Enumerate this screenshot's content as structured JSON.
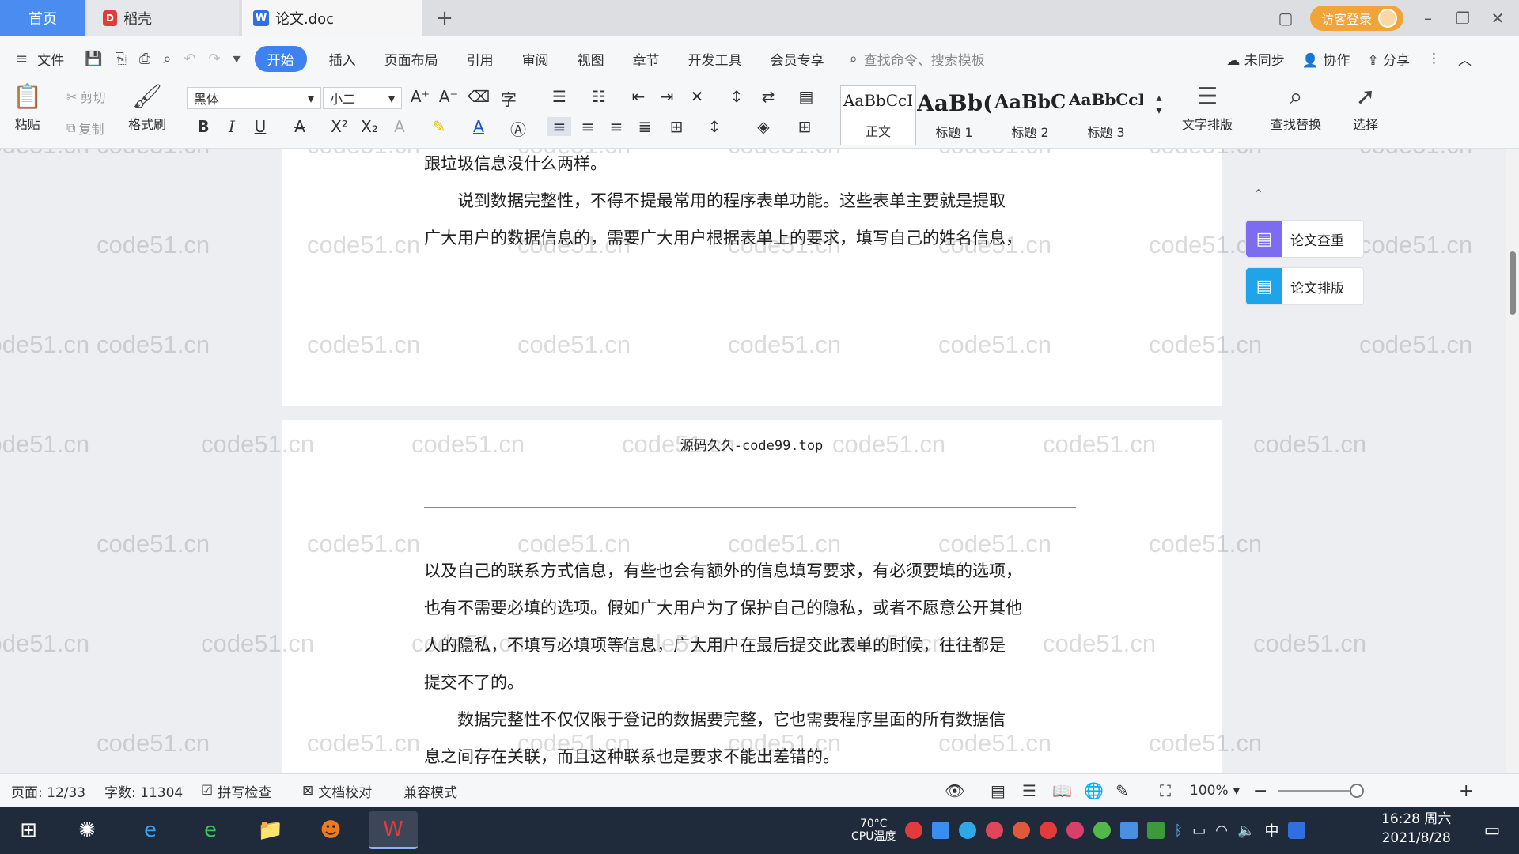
{
  "tabs": {
    "home": "首页",
    "docer": "稻壳",
    "doc": "论文.doc",
    "add": "+"
  },
  "titlebar": {
    "visitor_login": "访客登录"
  },
  "menu": {
    "file": "文件",
    "items": [
      "开始",
      "插入",
      "页面布局",
      "引用",
      "审阅",
      "视图",
      "章节",
      "开发工具",
      "会员专享"
    ],
    "search_command": "查找命令、搜索模板",
    "sync": "未同步",
    "collab": "协作",
    "share": "分享"
  },
  "ribbon": {
    "paste": "粘贴",
    "cut": "剪切",
    "copy": "复制",
    "format_painter": "格式刷",
    "font_name": "黑体",
    "font_size": "小二",
    "styles": [
      {
        "sample": "AaBbCcI",
        "name": "正文"
      },
      {
        "sample": "AaBb(",
        "name": "标题 1"
      },
      {
        "sample": "AaBbC",
        "name": "标题 2"
      },
      {
        "sample": "AaBbCcI",
        "name": "标题 3"
      }
    ],
    "text_layout": "文字排版",
    "find_replace": "查找替换",
    "select": "选择"
  },
  "document": {
    "page1_lines": [
      "跟垃圾信息没什么两样。",
      "　　说到数据完整性，不得不提最常用的程序表单功能。这些表单主要就是提取",
      "广大用户的数据信息的，需要广大用户根据表单上的要求，填写自己的姓名信息，"
    ],
    "header": "源码久久-code99.top",
    "page2_lines": [
      "以及自己的联系方式信息，有些也会有额外的信息填写要求，有必须要填的选项，",
      "也有不需要必填的选项。假如广大用户为了保护自己的隐私，或者不愿意公开其他",
      "人的隐私，不填写必填项等信息，广大用户在最后提交此表单的时候，往往都是",
      "提交不了的。",
      "　　数据完整性不仅仅限于登记的数据要完整，它也需要程序里面的所有数据信",
      "息之间存在关联，而且这种联系也是要求不能出差错的。"
    ],
    "watermark": "code51.cn"
  },
  "side_panel": {
    "check": "论文查重",
    "layout": "论文排版"
  },
  "statusbar": {
    "page": "页面: 12/33",
    "words": "字数: 11304",
    "spell": "拼写检查",
    "proof": "文档校对",
    "compat": "兼容模式",
    "zoom": "100%"
  },
  "taskbar": {
    "weather": "70°C",
    "cpu": "CPU温度",
    "ime": "中",
    "time": "16:28 周六",
    "date": "2021/8/28"
  },
  "colors": {
    "accent": "#3d82f0",
    "visitor": "#f2a33a",
    "taskbar": "#1f2a3b"
  }
}
